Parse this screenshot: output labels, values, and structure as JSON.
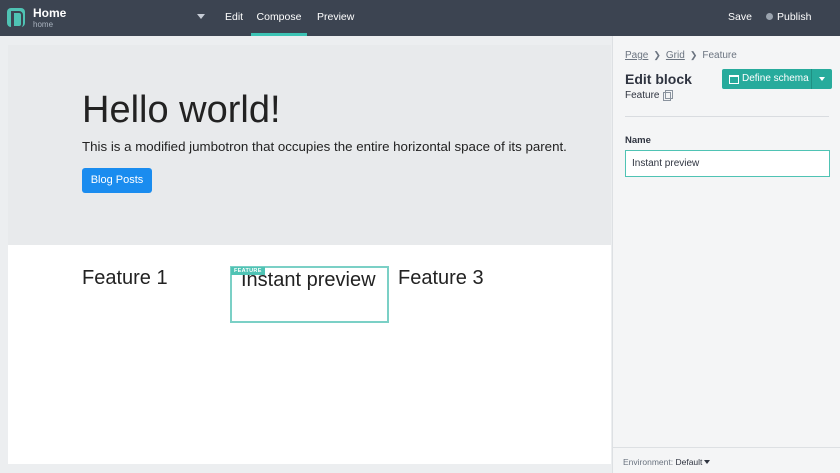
{
  "app": {
    "title": "Home",
    "subtitle": "home",
    "logo_icon": "bolt-logo-icon",
    "accent_color": "#3cc3b4"
  },
  "nav": {
    "tabs": [
      {
        "label": "Edit",
        "active": false
      },
      {
        "label": "Compose",
        "active": true
      },
      {
        "label": "Preview",
        "active": false
      }
    ],
    "save_label": "Save",
    "publish_label": "Publish"
  },
  "canvas": {
    "hero": {
      "title": "Hello world!",
      "text": "This is a modified jumbotron that occupies the entire horizontal space of its parent.",
      "button_label": "Blog Posts",
      "button_color": "#1a8cef"
    },
    "features": [
      {
        "label": "Feature 1"
      },
      {
        "label": "Instant preview",
        "selected": true,
        "badge": "FEATURE"
      },
      {
        "label": "Feature 3"
      }
    ]
  },
  "panel": {
    "breadcrumb": [
      "Page",
      "Grid",
      "Feature"
    ],
    "title": "Edit block",
    "block_type": "Feature",
    "define_schema_label": "Define schema",
    "field": {
      "label": "Name",
      "value": "Instant preview"
    },
    "environment": {
      "label": "Environment:",
      "value": "Default"
    }
  }
}
